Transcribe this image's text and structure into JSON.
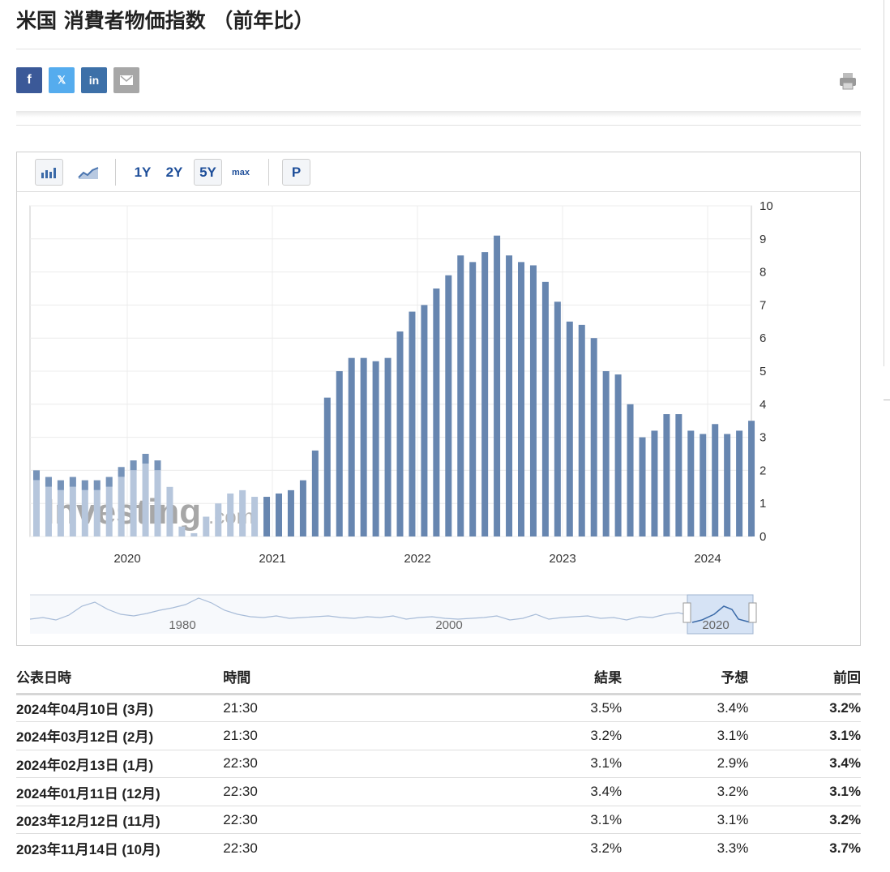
{
  "page": {
    "title": "米国 消費者物価指数 （前年比）"
  },
  "share": {
    "facebook": "f",
    "x": "𝕏",
    "linkedin": "in",
    "icons": [
      "facebook-icon",
      "x-icon",
      "linkedin-icon",
      "mail-icon",
      "print-icon"
    ]
  },
  "toolbar": {
    "periods": [
      "1Y",
      "2Y",
      "5Y",
      "max"
    ],
    "selected_period": "5Y",
    "p_button": "P",
    "chart_type_icons": [
      "bar-chart-icon",
      "area-chart-icon"
    ]
  },
  "colors": {
    "bar": "#6786b0",
    "bar_faded": "#b6c6dc",
    "red": "#e1261c",
    "green": "#2d9e2a",
    "accent": "#1f4f9a"
  },
  "chart_data": {
    "type": "bar",
    "ylim": [
      0,
      10
    ],
    "yticks": [
      0,
      1,
      2,
      3,
      4,
      5,
      6,
      7,
      8,
      9,
      10
    ],
    "y_axis_position": "right",
    "grid": true,
    "x_tick_labels": [
      "2020",
      "2021",
      "2022",
      "2023",
      "2024"
    ],
    "watermark": "Investing.com",
    "values": [
      2.0,
      1.8,
      1.7,
      1.8,
      1.7,
      1.7,
      1.8,
      2.1,
      2.3,
      2.5,
      2.3,
      1.5,
      0.3,
      0.1,
      0.6,
      1.0,
      1.3,
      1.4,
      1.2,
      1.2,
      1.3,
      1.4,
      1.7,
      2.6,
      4.2,
      5.0,
      5.4,
      5.4,
      5.3,
      5.4,
      6.2,
      6.8,
      7.0,
      7.5,
      7.9,
      8.5,
      8.3,
      8.6,
      9.1,
      8.5,
      8.3,
      8.2,
      7.7,
      7.1,
      6.5,
      6.4,
      6.0,
      5.0,
      4.9,
      4.0,
      3.0,
      3.2,
      3.7,
      3.7,
      3.2,
      3.1,
      3.4,
      3.1,
      3.2,
      3.5
    ],
    "navigator": {
      "labels": [
        "1980",
        "2000",
        "2020"
      ]
    }
  },
  "table": {
    "headers": {
      "date": "公表日時",
      "time": "時間",
      "result": "結果",
      "forecast": "予想",
      "previous": "前回"
    },
    "rows": [
      {
        "date": "2024年04月10日 (3月)",
        "time": "21:30",
        "result": "3.5%",
        "result_color": "red",
        "forecast": "3.4%",
        "previous": "3.2%"
      },
      {
        "date": "2024年03月12日 (2月)",
        "time": "21:30",
        "result": "3.2%",
        "result_color": "red",
        "forecast": "3.1%",
        "previous": "3.1%"
      },
      {
        "date": "2024年02月13日 (1月)",
        "time": "22:30",
        "result": "3.1%",
        "result_color": "red",
        "forecast": "2.9%",
        "previous": "3.4%"
      },
      {
        "date": "2024年01月11日 (12月)",
        "time": "22:30",
        "result": "3.4%",
        "result_color": "red",
        "forecast": "3.2%",
        "previous": "3.1%"
      },
      {
        "date": "2023年12月12日 (11月)",
        "time": "22:30",
        "result": "3.1%",
        "result_color": "",
        "forecast": "3.1%",
        "previous": "3.2%"
      },
      {
        "date": "2023年11月14日 (10月)",
        "time": "22:30",
        "result": "3.2%",
        "result_color": "green",
        "forecast": "3.3%",
        "previous": "3.7%"
      }
    ]
  }
}
